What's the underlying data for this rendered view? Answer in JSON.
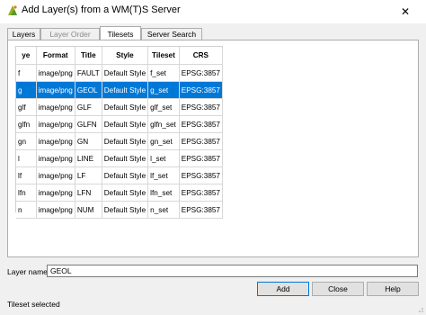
{
  "window": {
    "title": "Add Layer(s) from a WM(T)S Server",
    "close_glyph": "✕"
  },
  "tabs": [
    {
      "label": "Layers",
      "state": "normal"
    },
    {
      "label": "Layer Order",
      "state": "disabled"
    },
    {
      "label": "Tilesets",
      "state": "active"
    },
    {
      "label": "Server Search",
      "state": "normal"
    }
  ],
  "tileset_table": {
    "columns": [
      "ye",
      "Format",
      "Title",
      "Style",
      "Tileset",
      "CRS"
    ],
    "rows": [
      [
        "f",
        "image/png",
        "FAULT",
        "Default Style",
        "f_set",
        "EPSG:3857"
      ],
      [
        "g",
        "image/png",
        "GEOL",
        "Default Style",
        "g_set",
        "EPSG:3857"
      ],
      [
        "glf",
        "image/png",
        "GLF",
        "Default Style",
        "glf_set",
        "EPSG:3857"
      ],
      [
        "glfn",
        "image/png",
        "GLFN",
        "Default Style",
        "glfn_set",
        "EPSG:3857"
      ],
      [
        "gn",
        "image/png",
        "GN",
        "Default Style",
        "gn_set",
        "EPSG:3857"
      ],
      [
        "l",
        "image/png",
        "LINE",
        "Default Style",
        "l_set",
        "EPSG:3857"
      ],
      [
        "lf",
        "image/png",
        "LF",
        "Default Style",
        "lf_set",
        "EPSG:3857"
      ],
      [
        "lfn",
        "image/png",
        "LFN",
        "Default Style",
        "lfn_set",
        "EPSG:3857"
      ],
      [
        "n",
        "image/png",
        "NUM",
        "Default Style",
        "n_set",
        "EPSG:3857"
      ]
    ],
    "selected_row": 1
  },
  "layer_name": {
    "label": "Layer name",
    "value": "GEOL"
  },
  "buttons": {
    "add": "Add",
    "close": "Close",
    "help": "Help"
  },
  "status_text": "Tileset selected",
  "colors": {
    "selection": "#0078d7",
    "background": "#f0f0f0"
  }
}
